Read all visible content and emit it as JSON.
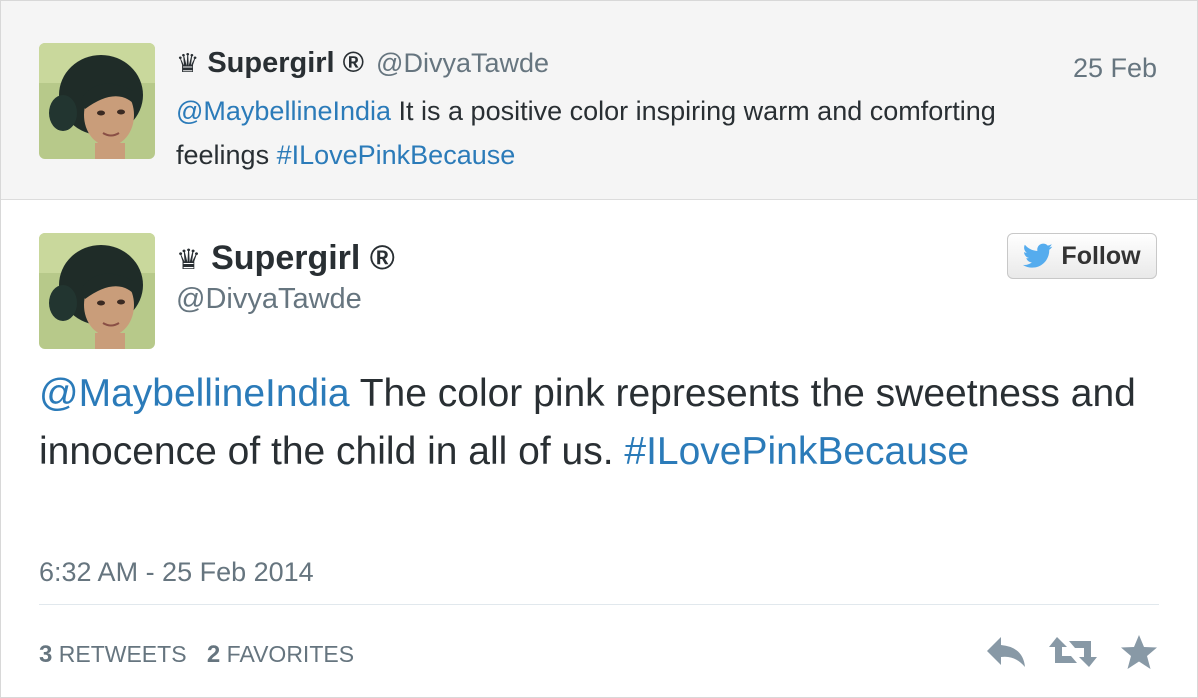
{
  "context_tweet": {
    "author_prefix": "♛",
    "author_name": "Supergirl ®",
    "handle": "@DivyaTawde",
    "date": "25 Feb",
    "mention": "@MaybellineIndia",
    "text_body": " It is a positive color inspiring warm and comforting feelings ",
    "hashtag": "#ILovePinkBecause"
  },
  "main_tweet": {
    "author_prefix": "♛",
    "author_name": "Supergirl ®",
    "handle": "@DivyaTawde",
    "follow_label": "Follow",
    "mention": "@MaybellineIndia",
    "text_body": " The color pink represents the sweetness and innocence of the child in all of us. ",
    "hashtag": "#ILovePinkBecause",
    "timestamp": "6:32 AM - 25 Feb 2014",
    "retweets_count": "3",
    "retweets_label": "RETWEETS",
    "favorites_count": "2",
    "favorites_label": "FAVORITES"
  },
  "actions": [
    "reply-icon",
    "retweet-icon",
    "favorite-icon"
  ],
  "colors": {
    "link": "#2b7bb9",
    "text": "#292f33",
    "muted": "#66757f",
    "icon": "#8899a6",
    "bird": "#55acee"
  }
}
